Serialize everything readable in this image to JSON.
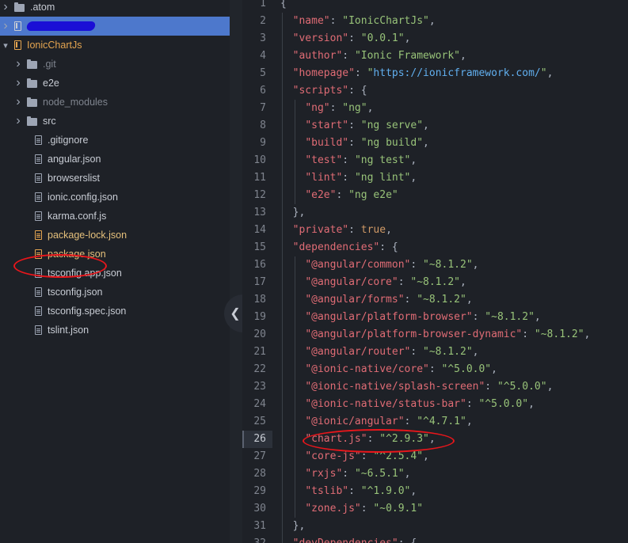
{
  "sidebar": {
    "items": [
      {
        "label": ".atom",
        "type": "folder",
        "expanded": false,
        "level": 0
      },
      {
        "label": "",
        "type": "repo",
        "selected": true,
        "redacted": true,
        "level": 0
      },
      {
        "label": "IonicChartJs",
        "type": "repo",
        "expanded": true,
        "level": 0
      },
      {
        "label": ".git",
        "type": "folder",
        "expanded": false,
        "muted": true,
        "level": 1
      },
      {
        "label": "e2e",
        "type": "folder",
        "expanded": false,
        "level": 1
      },
      {
        "label": "node_modules",
        "type": "folder",
        "expanded": false,
        "muted": true,
        "level": 1
      },
      {
        "label": "src",
        "type": "folder",
        "expanded": false,
        "level": 1
      },
      {
        "label": ".gitignore",
        "type": "file",
        "level": 1
      },
      {
        "label": "angular.json",
        "type": "file",
        "level": 1
      },
      {
        "label": "browserslist",
        "type": "file",
        "level": 1
      },
      {
        "label": "ionic.config.json",
        "type": "file",
        "level": 1
      },
      {
        "label": "karma.conf.js",
        "type": "file",
        "level": 1
      },
      {
        "label": "package-lock.json",
        "type": "file",
        "modified": true,
        "level": 1
      },
      {
        "label": "package.json",
        "type": "file",
        "modified": true,
        "highlighted": true,
        "level": 1
      },
      {
        "label": "tsconfig.app.json",
        "type": "file",
        "level": 1
      },
      {
        "label": "tsconfig.json",
        "type": "file",
        "level": 1
      },
      {
        "label": "tsconfig.spec.json",
        "type": "file",
        "level": 1
      },
      {
        "label": "tslint.json",
        "type": "file",
        "level": 1
      }
    ]
  },
  "editor": {
    "active_line": 26,
    "lines": [
      {
        "n": "1",
        "parts": [
          [
            "p",
            "{"
          ]
        ]
      },
      {
        "n": "2",
        "parts": [
          [
            "p",
            "  "
          ],
          [
            "k",
            "\"name\""
          ],
          [
            "p",
            ": "
          ],
          [
            "s",
            "\"IonicChartJs\""
          ],
          [
            "p",
            ","
          ]
        ]
      },
      {
        "n": "3",
        "parts": [
          [
            "p",
            "  "
          ],
          [
            "k",
            "\"version\""
          ],
          [
            "p",
            ": "
          ],
          [
            "s",
            "\"0.0.1\""
          ],
          [
            "p",
            ","
          ]
        ]
      },
      {
        "n": "4",
        "parts": [
          [
            "p",
            "  "
          ],
          [
            "k",
            "\"author\""
          ],
          [
            "p",
            ": "
          ],
          [
            "s",
            "\"Ionic Framework\""
          ],
          [
            "p",
            ","
          ]
        ]
      },
      {
        "n": "5",
        "parts": [
          [
            "p",
            "  "
          ],
          [
            "k",
            "\"homepage\""
          ],
          [
            "p",
            ": "
          ],
          [
            "s",
            "\""
          ],
          [
            "u",
            "https://ionicframework.com/"
          ],
          [
            "s",
            "\""
          ],
          [
            "p",
            ","
          ]
        ]
      },
      {
        "n": "6",
        "parts": [
          [
            "p",
            "  "
          ],
          [
            "k",
            "\"scripts\""
          ],
          [
            "p",
            ": {"
          ]
        ]
      },
      {
        "n": "7",
        "parts": [
          [
            "p",
            "    "
          ],
          [
            "k",
            "\"ng\""
          ],
          [
            "p",
            ": "
          ],
          [
            "s",
            "\"ng\""
          ],
          [
            "p",
            ","
          ]
        ]
      },
      {
        "n": "8",
        "parts": [
          [
            "p",
            "    "
          ],
          [
            "k",
            "\"start\""
          ],
          [
            "p",
            ": "
          ],
          [
            "s",
            "\"ng serve\""
          ],
          [
            "p",
            ","
          ]
        ]
      },
      {
        "n": "9",
        "parts": [
          [
            "p",
            "    "
          ],
          [
            "k",
            "\"build\""
          ],
          [
            "p",
            ": "
          ],
          [
            "s",
            "\"ng build\""
          ],
          [
            "p",
            ","
          ]
        ]
      },
      {
        "n": "10",
        "parts": [
          [
            "p",
            "    "
          ],
          [
            "k",
            "\"test\""
          ],
          [
            "p",
            ": "
          ],
          [
            "s",
            "\"ng test\""
          ],
          [
            "p",
            ","
          ]
        ]
      },
      {
        "n": "11",
        "parts": [
          [
            "p",
            "    "
          ],
          [
            "k",
            "\"lint\""
          ],
          [
            "p",
            ": "
          ],
          [
            "s",
            "\"ng lint\""
          ],
          [
            "p",
            ","
          ]
        ]
      },
      {
        "n": "12",
        "parts": [
          [
            "p",
            "    "
          ],
          [
            "k",
            "\"e2e\""
          ],
          [
            "p",
            ": "
          ],
          [
            "s",
            "\"ng e2e\""
          ]
        ]
      },
      {
        "n": "13",
        "parts": [
          [
            "p",
            "  },"
          ]
        ]
      },
      {
        "n": "14",
        "parts": [
          [
            "p",
            "  "
          ],
          [
            "k",
            "\"private\""
          ],
          [
            "p",
            ": "
          ],
          [
            "b",
            "true"
          ],
          [
            "p",
            ","
          ]
        ]
      },
      {
        "n": "15",
        "parts": [
          [
            "p",
            "  "
          ],
          [
            "k",
            "\"dependencies\""
          ],
          [
            "p",
            ": {"
          ]
        ]
      },
      {
        "n": "16",
        "parts": [
          [
            "p",
            "    "
          ],
          [
            "k",
            "\"@angular/common\""
          ],
          [
            "p",
            ": "
          ],
          [
            "s",
            "\"~8.1.2\""
          ],
          [
            "p",
            ","
          ]
        ]
      },
      {
        "n": "17",
        "parts": [
          [
            "p",
            "    "
          ],
          [
            "k",
            "\"@angular/core\""
          ],
          [
            "p",
            ": "
          ],
          [
            "s",
            "\"~8.1.2\""
          ],
          [
            "p",
            ","
          ]
        ]
      },
      {
        "n": "18",
        "parts": [
          [
            "p",
            "    "
          ],
          [
            "k",
            "\"@angular/forms\""
          ],
          [
            "p",
            ": "
          ],
          [
            "s",
            "\"~8.1.2\""
          ],
          [
            "p",
            ","
          ]
        ]
      },
      {
        "n": "19",
        "parts": [
          [
            "p",
            "    "
          ],
          [
            "k",
            "\"@angular/platform-browser\""
          ],
          [
            "p",
            ": "
          ],
          [
            "s",
            "\"~8.1.2\""
          ],
          [
            "p",
            ","
          ]
        ]
      },
      {
        "n": "20",
        "parts": [
          [
            "p",
            "    "
          ],
          [
            "k",
            "\"@angular/platform-browser-dynamic\""
          ],
          [
            "p",
            ": "
          ],
          [
            "s",
            "\"~8.1.2\""
          ],
          [
            "p",
            ","
          ]
        ]
      },
      {
        "n": "21",
        "parts": [
          [
            "p",
            "    "
          ],
          [
            "k",
            "\"@angular/router\""
          ],
          [
            "p",
            ": "
          ],
          [
            "s",
            "\"~8.1.2\""
          ],
          [
            "p",
            ","
          ]
        ]
      },
      {
        "n": "22",
        "parts": [
          [
            "p",
            "    "
          ],
          [
            "k",
            "\"@ionic-native/core\""
          ],
          [
            "p",
            ": "
          ],
          [
            "s",
            "\"^5.0.0\""
          ],
          [
            "p",
            ","
          ]
        ]
      },
      {
        "n": "23",
        "parts": [
          [
            "p",
            "    "
          ],
          [
            "k",
            "\"@ionic-native/splash-screen\""
          ],
          [
            "p",
            ": "
          ],
          [
            "s",
            "\"^5.0.0\""
          ],
          [
            "p",
            ","
          ]
        ]
      },
      {
        "n": "24",
        "parts": [
          [
            "p",
            "    "
          ],
          [
            "k",
            "\"@ionic-native/status-bar\""
          ],
          [
            "p",
            ": "
          ],
          [
            "s",
            "\"^5.0.0\""
          ],
          [
            "p",
            ","
          ]
        ]
      },
      {
        "n": "25",
        "parts": [
          [
            "p",
            "    "
          ],
          [
            "k",
            "\"@ionic/angular\""
          ],
          [
            "p",
            ": "
          ],
          [
            "s",
            "\"^4.7.1\""
          ],
          [
            "p",
            ","
          ]
        ]
      },
      {
        "n": "26",
        "parts": [
          [
            "p",
            "    "
          ],
          [
            "k",
            "\"chart.js\""
          ],
          [
            "p",
            ": "
          ],
          [
            "s",
            "\"^2.9.3\""
          ],
          [
            "p",
            ","
          ]
        ]
      },
      {
        "n": "27",
        "parts": [
          [
            "p",
            "    "
          ],
          [
            "k",
            "\"core-js\""
          ],
          [
            "p",
            ": "
          ],
          [
            "s",
            "\"^2.5.4\""
          ],
          [
            "p",
            ","
          ]
        ]
      },
      {
        "n": "28",
        "parts": [
          [
            "p",
            "    "
          ],
          [
            "k",
            "\"rxjs\""
          ],
          [
            "p",
            ": "
          ],
          [
            "s",
            "\"~6.5.1\""
          ],
          [
            "p",
            ","
          ]
        ]
      },
      {
        "n": "29",
        "parts": [
          [
            "p",
            "    "
          ],
          [
            "k",
            "\"tslib\""
          ],
          [
            "p",
            ": "
          ],
          [
            "s",
            "\"^1.9.0\""
          ],
          [
            "p",
            ","
          ]
        ]
      },
      {
        "n": "30",
        "parts": [
          [
            "p",
            "    "
          ],
          [
            "k",
            "\"zone.js\""
          ],
          [
            "p",
            ": "
          ],
          [
            "s",
            "\"~0.9.1\""
          ]
        ]
      },
      {
        "n": "31",
        "parts": [
          [
            "p",
            "  },"
          ]
        ]
      },
      {
        "n": "32",
        "parts": [
          [
            "p",
            "  "
          ],
          [
            "k",
            "\"devDependencies\""
          ],
          [
            "p",
            ": {"
          ]
        ]
      }
    ]
  },
  "colors": {
    "background": "#1e2127",
    "selection": "#4d78cc",
    "key": "#e06c75",
    "string": "#98c379",
    "url": "#61afef",
    "boolean": "#d19a66",
    "annotation": "#e8161b"
  },
  "icons": {
    "collapse_handle": "chevron-left-icon"
  }
}
